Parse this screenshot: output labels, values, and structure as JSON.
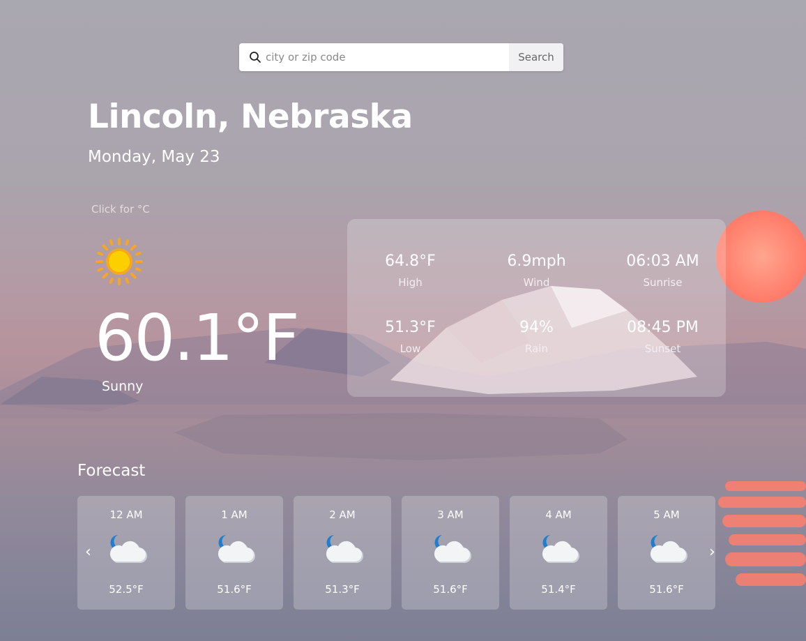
{
  "search": {
    "placeholder": "city or zip code",
    "button_label": "Search",
    "icon": "search-icon"
  },
  "location": {
    "city": "Lincoln, Nebraska",
    "date": "Monday, May 23"
  },
  "unit_toggle": "Click for °C",
  "current": {
    "icon": "sun-icon",
    "temperature": "60.1°F",
    "condition": "Sunny"
  },
  "stats": [
    {
      "value": "64.8°F",
      "label": "High"
    },
    {
      "value": "6.9mph",
      "label": "Wind"
    },
    {
      "value": "06:03 AM",
      "label": "Sunrise"
    },
    {
      "value": "51.3°F",
      "label": "Low"
    },
    {
      "value": "94%",
      "label": "Rain"
    },
    {
      "value": "08:45 PM",
      "label": "Sunset"
    }
  ],
  "forecast": {
    "title": "Forecast",
    "prev_icon": "chevron-left-icon",
    "next_icon": "chevron-right-icon",
    "items": [
      {
        "time": "12 AM",
        "icon": "moon-cloud-icon",
        "temp": "52.5°F"
      },
      {
        "time": "1 AM",
        "icon": "moon-cloud-icon",
        "temp": "51.6°F"
      },
      {
        "time": "2 AM",
        "icon": "moon-cloud-icon",
        "temp": "51.3°F"
      },
      {
        "time": "3 AM",
        "icon": "moon-cloud-icon",
        "temp": "51.6°F"
      },
      {
        "time": "4 AM",
        "icon": "moon-cloud-icon",
        "temp": "51.4°F"
      },
      {
        "time": "5 AM",
        "icon": "moon-cloud-icon",
        "temp": "51.6°F"
      }
    ]
  },
  "colors": {
    "sun": "#fcd000",
    "sun_rays": "#f5a623",
    "moon": "#1e7fd0",
    "sunset_sun": "#ff8d74"
  }
}
